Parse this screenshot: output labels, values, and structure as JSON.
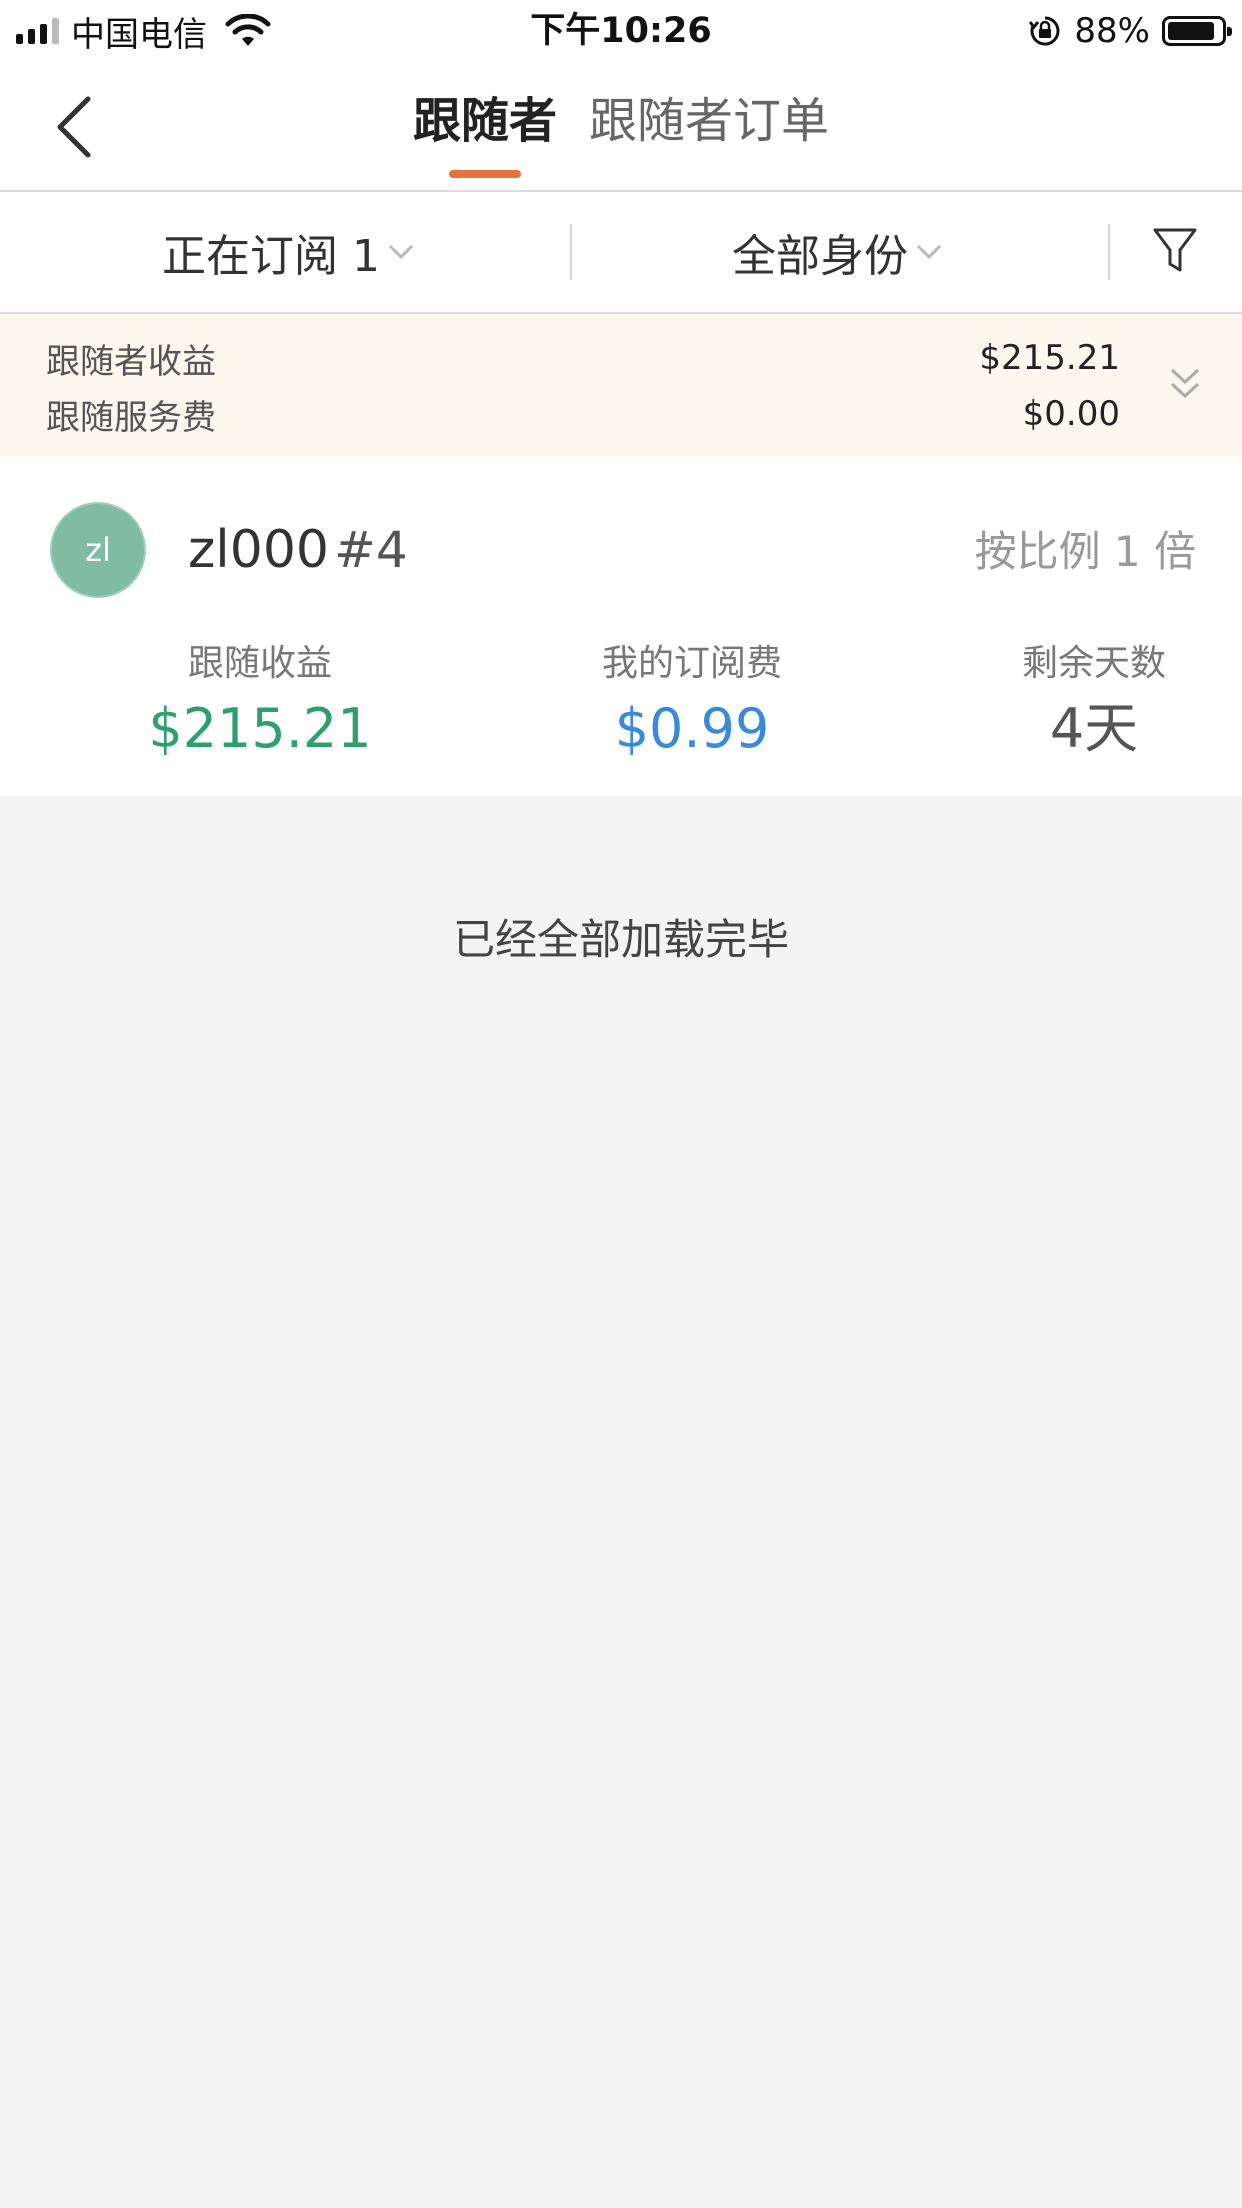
{
  "status_bar": {
    "carrier": "中国电信",
    "time": "下午10:26",
    "battery_percent": "88%",
    "battery_level": 0.88
  },
  "nav": {
    "tabs": [
      {
        "label": "跟随者",
        "active": true
      },
      {
        "label": "跟随者订单",
        "active": false
      }
    ]
  },
  "filters": {
    "subscription": "正在订阅 1",
    "identity": "全部身份"
  },
  "summary": {
    "follower_earnings_label": "跟随者收益",
    "follower_earnings_value": "$215.21",
    "service_fee_label": "跟随服务费",
    "service_fee_value": "$0.00"
  },
  "follower": {
    "avatar_initials": "zl",
    "name": "zl000",
    "rank": "#4",
    "ratio": "按比例 1 倍",
    "metrics": [
      {
        "label": "跟随收益",
        "value": "$215.21"
      },
      {
        "label": "我的订阅费",
        "value": "$0.99"
      },
      {
        "label": "剩余天数",
        "value": "4天"
      }
    ]
  },
  "list_end_text": "已经全部加载完毕",
  "colors": {
    "accent": "#e8703a",
    "positive": "#2ea06b",
    "link": "#3b8ad9",
    "avatar": "#7fbca1",
    "summary_bg": "#fdf8ee"
  },
  "icons": {
    "back": "chevron-left-icon",
    "filter": "funnel-icon",
    "expand": "double-chevron-down-icon"
  }
}
